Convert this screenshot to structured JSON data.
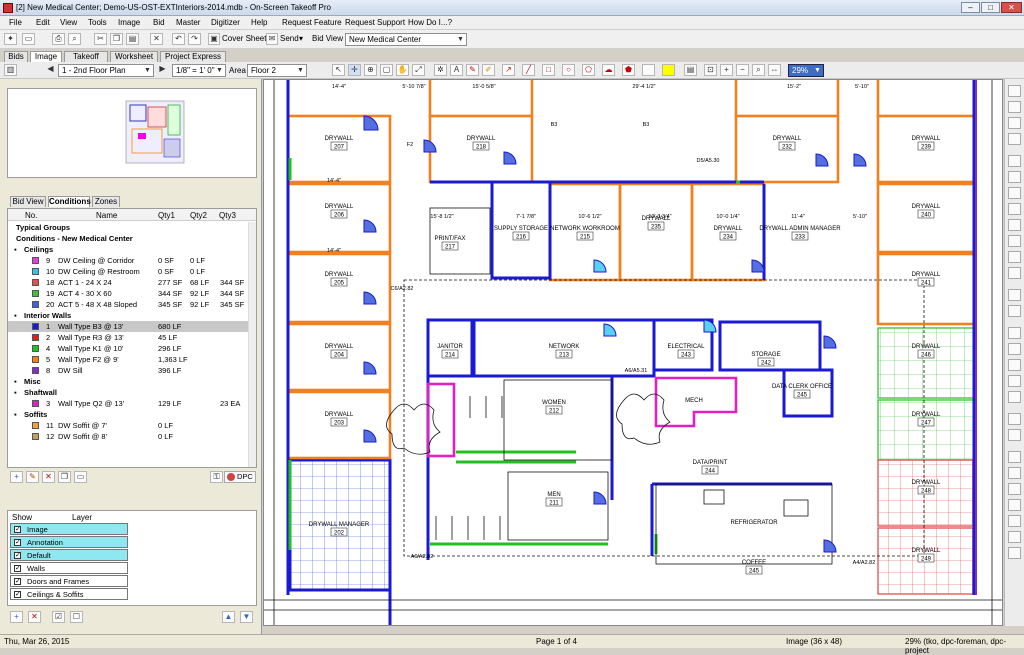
{
  "window": {
    "title": "[2] New Medical Center; Demo-US-OST-EXTInteriors-2014.mdb - On-Screen Takeoff Pro"
  },
  "menu": [
    "File",
    "Edit",
    "View",
    "Tools",
    "Image",
    "Bid",
    "Master",
    "Digitizer",
    "Help",
    "Request Feature",
    "Request Support",
    "How Do I...?"
  ],
  "toolbar": {
    "cover_sheet": "Cover Sheet",
    "send": "Send",
    "bid_view": "Bid View",
    "bid_combo": "New Medical Center"
  },
  "top_tabs": [
    "Bids",
    "Image",
    "Takeoff",
    "Worksheet",
    "Project Express"
  ],
  "image_toolbar": {
    "page": "1 - 2nd Floor Plan",
    "scale": "1/8\" = 1' 0\"",
    "area_label": "Area",
    "area": "Floor 2",
    "zoom": "29%"
  },
  "left_tabs": [
    "Bid View",
    "Conditions",
    "Zones"
  ],
  "conditions": {
    "headers": [
      "No.",
      "Name",
      "Qty1",
      "Qty2",
      "Qty3"
    ],
    "rows": [
      {
        "kind": "group",
        "name": "Typical Groups"
      },
      {
        "kind": "group",
        "name": "Conditions - New Medical Center"
      },
      {
        "kind": "sub",
        "name": "Ceilings"
      },
      {
        "kind": "item",
        "no": "9",
        "name": "DW Ceiling @ Corridor",
        "q1": "0 SF",
        "q2": "0 LF",
        "q3": "",
        "color": "#e040e0"
      },
      {
        "kind": "item",
        "no": "10",
        "name": "DW Ceiling @ Restroom",
        "q1": "0 SF",
        "q2": "0 LF",
        "q3": "",
        "color": "#40c0e0"
      },
      {
        "kind": "item",
        "no": "18",
        "name": "ACT 1 - 24 X 24",
        "q1": "277 SF",
        "q2": "68 LF",
        "q3": "344 SF",
        "color": "#e05050"
      },
      {
        "kind": "item",
        "no": "19",
        "name": "ACT 4 - 30 X 60",
        "q1": "344 SF",
        "q2": "92 LF",
        "q3": "344 SF",
        "color": "#40c040"
      },
      {
        "kind": "item",
        "no": "20",
        "name": "ACT 5 - 48 X 48 Sloped",
        "q1": "345 SF",
        "q2": "92 LF",
        "q3": "345 SF",
        "color": "#4060e0"
      },
      {
        "kind": "sub",
        "name": "Interior Walls"
      },
      {
        "kind": "item",
        "no": "1",
        "name": "Wall Type B3 @ 13'",
        "q1": "680 LF",
        "q2": "",
        "q3": "",
        "color": "#1a1ad0",
        "sel": true
      },
      {
        "kind": "item",
        "no": "2",
        "name": "Wall Type R3 @ 13'",
        "q1": "45 LF",
        "q2": "",
        "q3": "",
        "color": "#e02020"
      },
      {
        "kind": "item",
        "no": "4",
        "name": "Wall Type K1 @ 10'",
        "q1": "296 LF",
        "q2": "",
        "q3": "",
        "color": "#20c020"
      },
      {
        "kind": "item",
        "no": "5",
        "name": "Wall Type F2 @ 9'",
        "q1": "1,363 LF",
        "q2": "",
        "q3": "",
        "color": "#f08020"
      },
      {
        "kind": "item",
        "no": "8",
        "name": "DW Sill",
        "q1": "396 LF",
        "q2": "",
        "q3": "",
        "color": "#8030c0"
      },
      {
        "kind": "sub",
        "name": "Misc"
      },
      {
        "kind": "sub",
        "name": "Shaftwall"
      },
      {
        "kind": "item",
        "no": "3",
        "name": "Wall Type Q2 @ 13'",
        "q1": "129 LF",
        "q2": "",
        "q3": "23 EA",
        "color": "#e020c0"
      },
      {
        "kind": "sub",
        "name": "Soffits"
      },
      {
        "kind": "item",
        "no": "11",
        "name": "DW Soffit @ 7'",
        "q1": "0 LF",
        "q2": "",
        "q3": "",
        "color": "#f0a040"
      },
      {
        "kind": "item",
        "no": "12",
        "name": "DW Soffit @ 8'",
        "q1": "0 LF",
        "q2": "",
        "q3": "",
        "color": "#c0a060"
      }
    ],
    "dpc_label": "DPC"
  },
  "layers": {
    "headers": [
      "Show",
      "Layer"
    ],
    "rows": [
      {
        "name": "Image",
        "checked": true,
        "hl": true
      },
      {
        "name": "Annotation",
        "checked": true,
        "hl": true
      },
      {
        "name": "Default",
        "checked": true,
        "hl": true
      },
      {
        "name": "Walls",
        "checked": true,
        "hl": false
      },
      {
        "name": "Doors and Frames",
        "checked": true,
        "hl": false
      },
      {
        "name": "Ceilings & Soffits",
        "checked": true,
        "hl": false
      }
    ]
  },
  "rooms": [
    {
      "name": "DRYWALL",
      "num": "207"
    },
    {
      "name": "DRYWALL",
      "num": "218"
    },
    {
      "name": "DRYWALL",
      "num": "232"
    },
    {
      "name": "DRYWALL",
      "num": "239"
    },
    {
      "name": "DRYWALL",
      "num": "206"
    },
    {
      "name": "DRYWALL",
      "num": "240"
    },
    {
      "name": "PRINT/FAX",
      "num": "217"
    },
    {
      "name": "SUPPLY STORAGE",
      "num": "216"
    },
    {
      "name": "NETWORK WORKROOM",
      "num": "215"
    },
    {
      "name": "DRYWALL",
      "num": "235"
    },
    {
      "name": "DRYWALL",
      "num": "234"
    },
    {
      "name": "DRYWALL ADMIN MANAGER",
      "num": "233"
    },
    {
      "name": "DRYWALL",
      "num": "205"
    },
    {
      "name": "DRYWALL",
      "num": "241"
    },
    {
      "name": "DRYWALL",
      "num": "204"
    },
    {
      "name": "JANITOR",
      "num": "214"
    },
    {
      "name": "NETWORK",
      "num": "213"
    },
    {
      "name": "ELECTRICAL",
      "num": "243"
    },
    {
      "name": "STORAGE",
      "num": "242"
    },
    {
      "name": "DATA CLERK OFFICE",
      "num": "245"
    },
    {
      "name": "DRYWALL",
      "num": "246"
    },
    {
      "name": "DRYWALL",
      "num": "203"
    },
    {
      "name": "WOMEN",
      "num": "212"
    },
    {
      "name": "MECH",
      "num": ""
    },
    {
      "name": "DATA/PRINT",
      "num": "244"
    },
    {
      "name": "DRYWALL",
      "num": "247"
    },
    {
      "name": "MEN",
      "num": "211"
    },
    {
      "name": "REFRIGERATOR",
      "num": ""
    },
    {
      "name": "DRYWALL",
      "num": "248"
    },
    {
      "name": "DRYWALL MANAGER",
      "num": "202"
    },
    {
      "name": "COFFEE",
      "num": "245"
    },
    {
      "name": "DRYWALL",
      "num": "249"
    }
  ],
  "dims": [
    "14'-4\"",
    "5'-10 7/8\"",
    "15'-0 5/8\"",
    "29'-4 1/2\"",
    "15'-2\"",
    "5'-10\"",
    "14'-4\"",
    "14'-4\"",
    "15'-8 1/2\"",
    "7'-1 7/8\"",
    "10'-6 1/2\"",
    "10'-3 3/4\"",
    "10'-0 1/4\"",
    "11'-4\"",
    "5'-10\""
  ],
  "tags": [
    "B3",
    "B3",
    "F2",
    "D5/A5.30",
    "C6/A2.82",
    "A6/A5.31",
    "A6/A2.82",
    "A4/A2.82"
  ],
  "status": {
    "date": "Thu, Mar 26, 2015",
    "page": "Page 1 of 4",
    "image": "Image (36 x 48)",
    "right": "29%  (tko, dpc-foreman, dpc-project"
  }
}
